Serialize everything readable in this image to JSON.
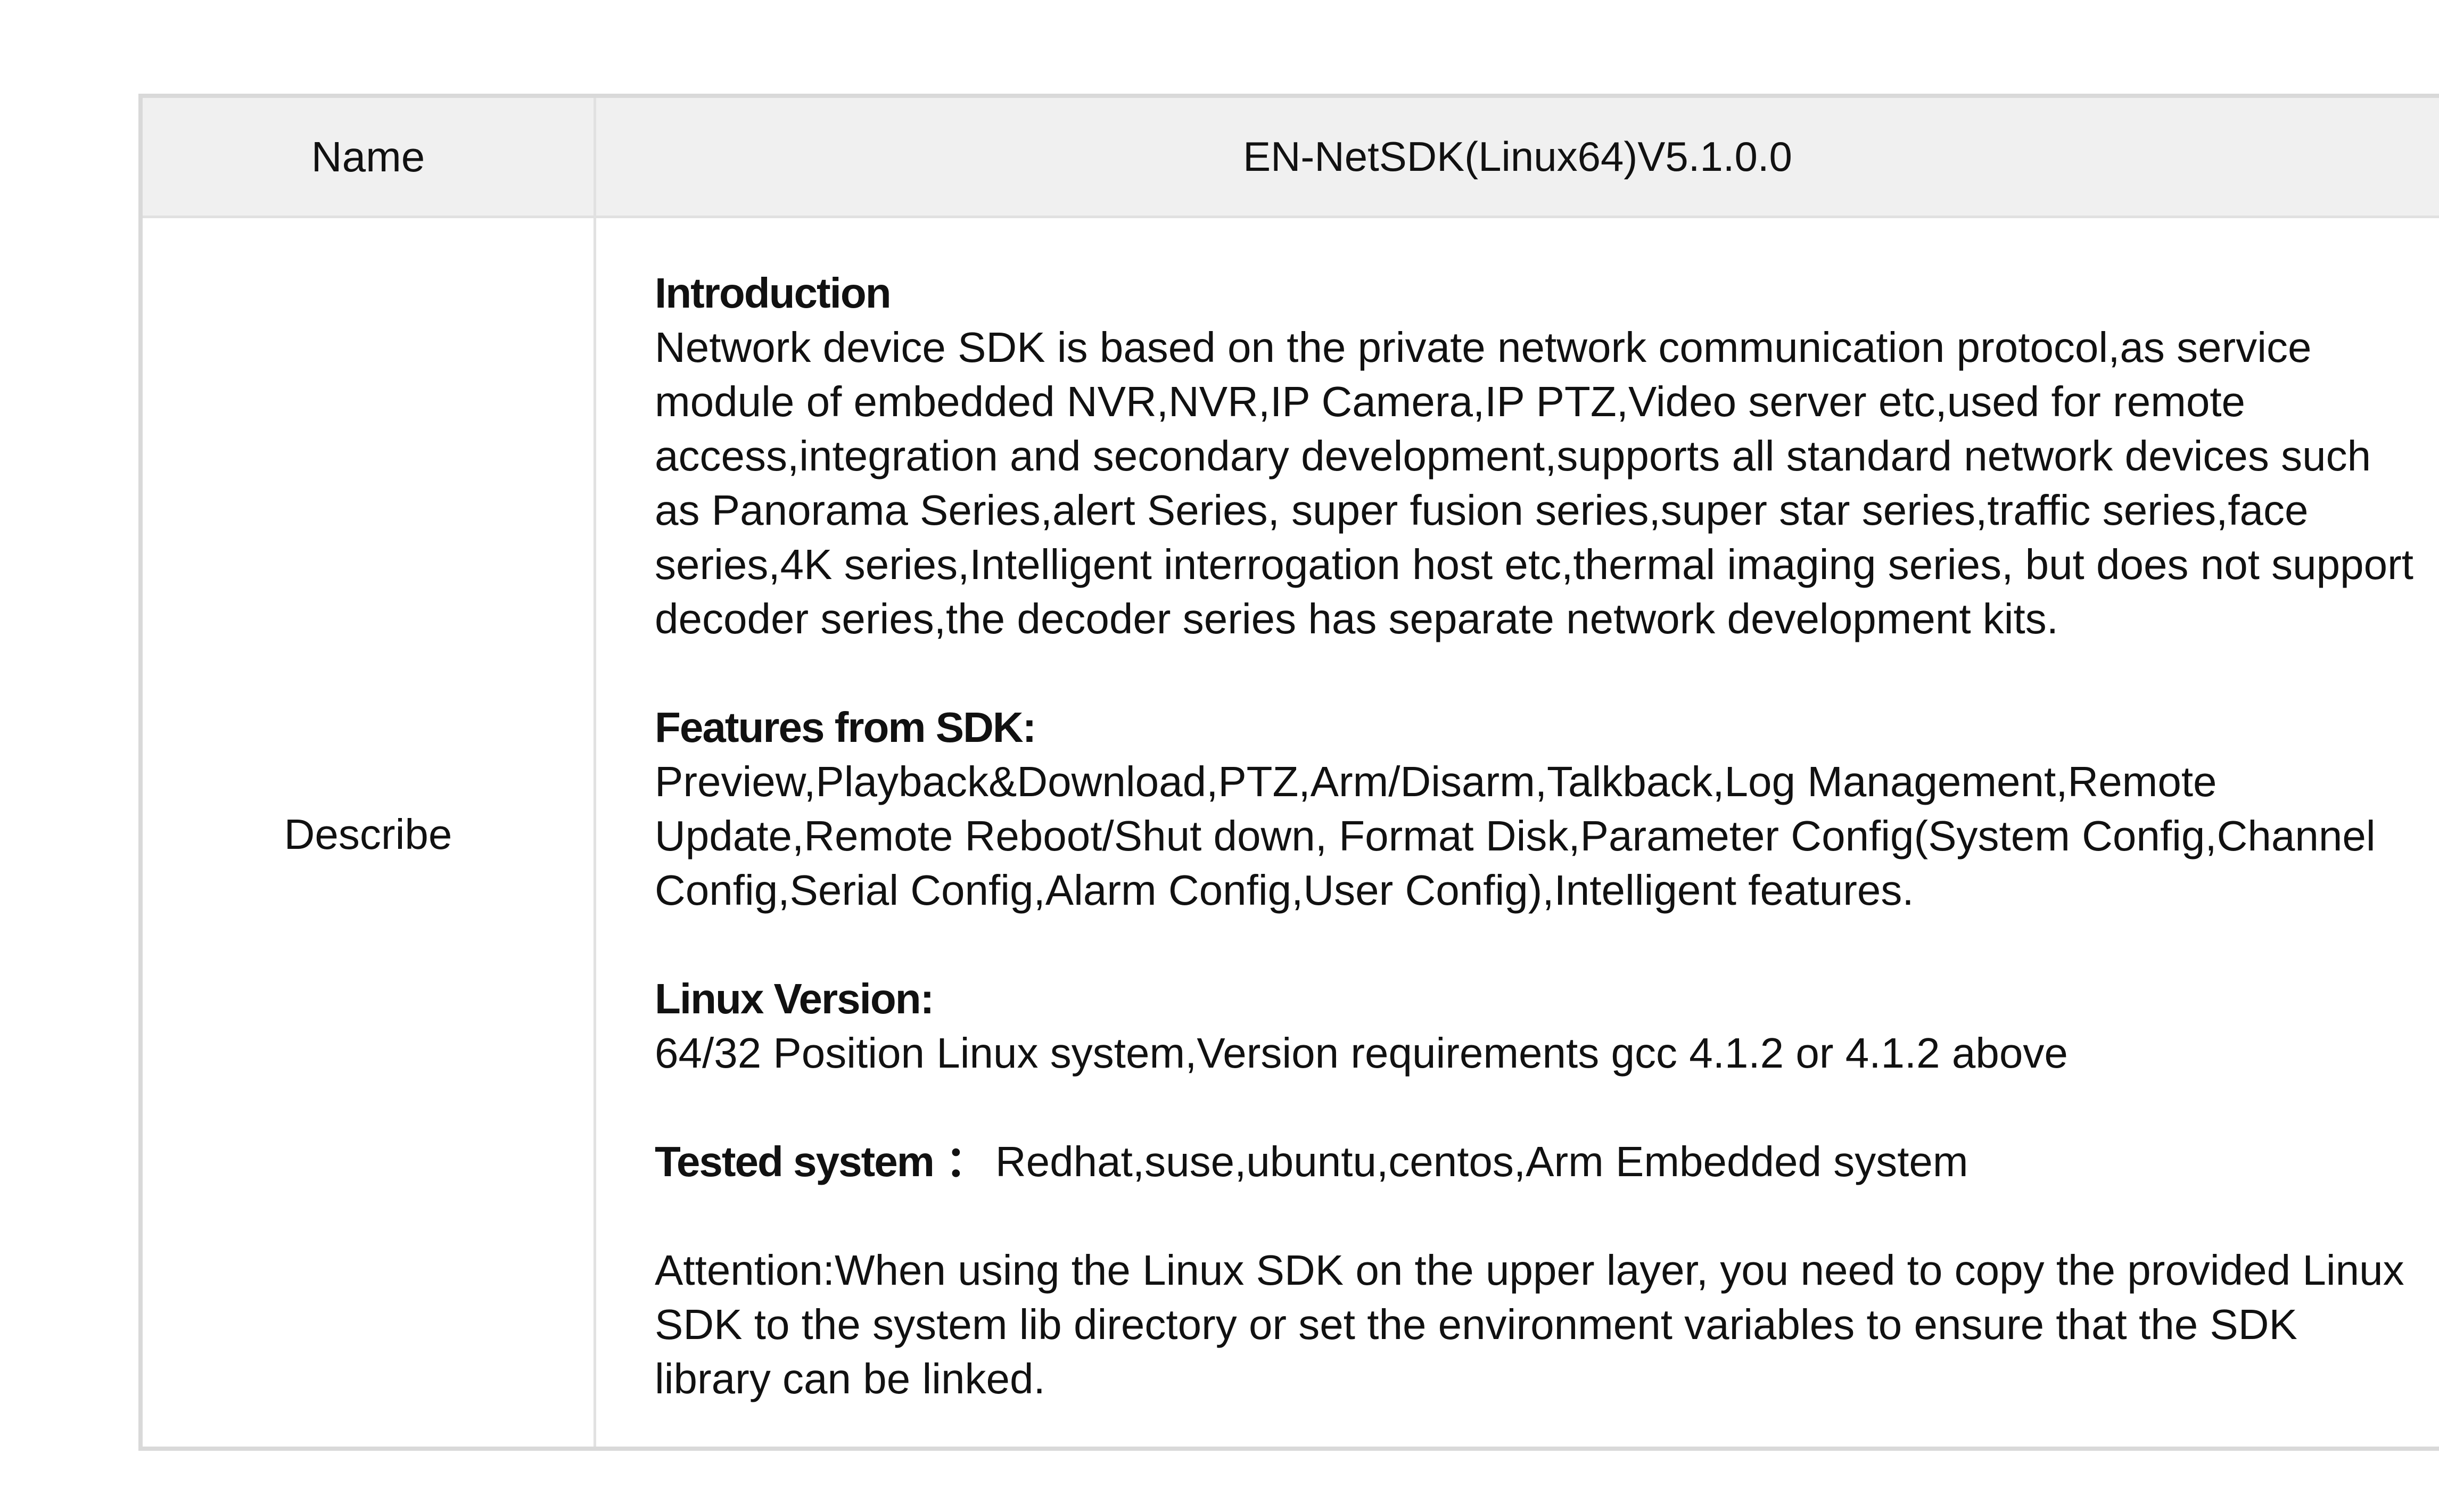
{
  "table": {
    "header": {
      "label": "Name",
      "value": "EN-NetSDK(Linux64)V5.1.0.0"
    },
    "body": {
      "label": "Describe",
      "sections": {
        "intro": {
          "heading": "Introduction",
          "text": "Network device SDK is based on the private network communication protocol,as service module of embedded NVR,NVR,IP Camera,IP PTZ,Video server etc,used for remote access,integration and secondary development,supports all standard network devices such as Panorama Series,alert Series, super fusion series,super star series,traffic series,face series,4K series,Intelligent interrogation host etc,thermal imaging series, but does not support decoder series,the decoder series has separate network development kits."
        },
        "features": {
          "heading": "Features from SDK:",
          "text": "Preview,Playback&Download,PTZ,Arm/Disarm,Talkback,Log Management,Remote Update,Remote Reboot/Shut down, Format Disk,Parameter Config(System Config,Channel Config,Serial Config,Alarm Config,User Config),Intelligent features."
        },
        "linux": {
          "heading": "Linux Version:",
          "text": "64/32 Position Linux system,Version requirements gcc 4.1.2 or 4.1.2 above"
        },
        "tested": {
          "heading": "Tested system",
          "colon": "：",
          "text": "Redhat,suse,ubuntu,centos,Arm Embedded system"
        },
        "attention": {
          "text": "Attention:When using the Linux SDK on the upper layer, you need to copy the provided Linux SDK to the system lib directory or set the environment variables to ensure that the SDK library can be linked."
        }
      }
    }
  }
}
